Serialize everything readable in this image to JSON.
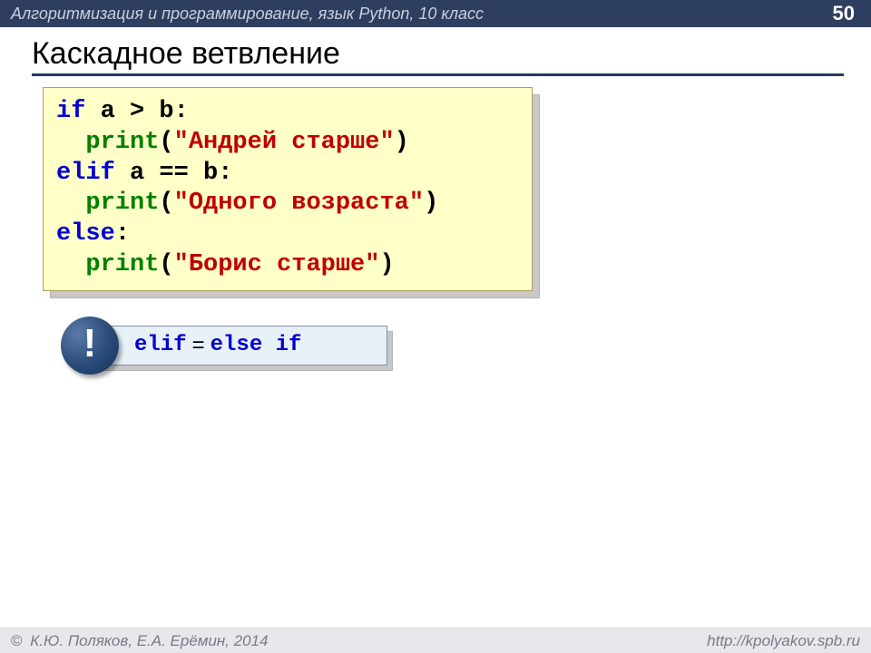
{
  "header": {
    "course": "Алгоритмизация и программирование, язык Python, 10 класс",
    "page": "50"
  },
  "title": "Каскадное ветвление",
  "code": {
    "l1_if": "if",
    "l1_rest": " a > b:",
    "l2_indent": "  ",
    "l2_print": "print",
    "l2_p1": "(",
    "l2_str": "\"Андрей старше\"",
    "l2_p2": ")",
    "l3_elif": "elif",
    "l3_rest": " a == b:",
    "l4_indent": "  ",
    "l4_print": "print",
    "l4_p1": "(",
    "l4_str": "\"Одного возраста\"",
    "l4_p2": ")",
    "l5_else": "else",
    "l5_rest": ":",
    "l6_indent": "  ",
    "l6_print": "print",
    "l6_p1": "(",
    "l6_str": "\"Борис старше\"",
    "l6_p2": ")"
  },
  "note": {
    "excl": "!",
    "elif": "elif",
    "eq": "=",
    "else": "else",
    "if": "if"
  },
  "footer": {
    "copyright_sym": "©",
    "copyright": "К.Ю. Поляков, Е.А. Ерёмин, 2014",
    "url": "http://kpolyakov.spb.ru"
  }
}
